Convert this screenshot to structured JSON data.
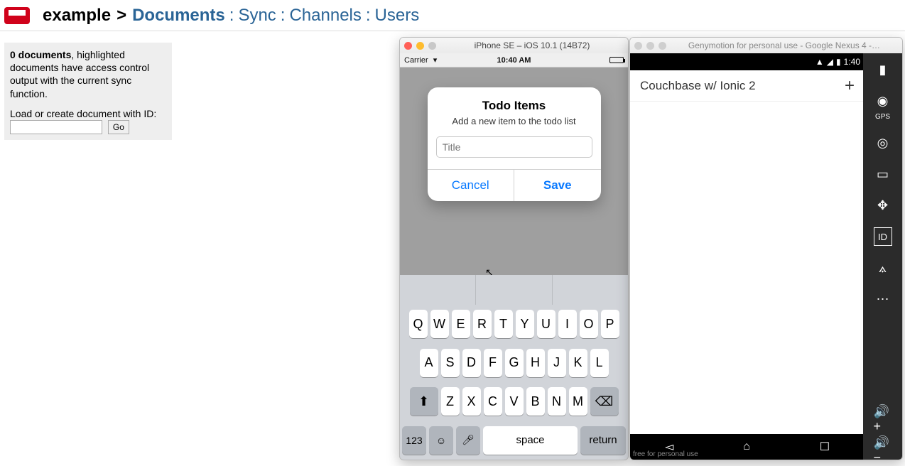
{
  "nav": {
    "db": "example",
    "links": [
      "Documents",
      "Sync",
      "Channels",
      "Users"
    ]
  },
  "info": {
    "count_label": "0 documents",
    "rest": ", highlighted documents have access control output with the current sync function.",
    "load_label": "Load or create document with ID:",
    "go": "Go"
  },
  "ios": {
    "window_title": "iPhone SE – iOS 10.1 (14B72)",
    "carrier": "Carrier",
    "time": "10:40 AM",
    "dialog_title": "Todo Items",
    "dialog_text": "Add a new item to the todo list",
    "placeholder": "Title",
    "cancel": "Cancel",
    "save": "Save",
    "rows": [
      [
        "Q",
        "W",
        "E",
        "R",
        "T",
        "Y",
        "U",
        "I",
        "O",
        "P"
      ],
      [
        "A",
        "S",
        "D",
        "F",
        "G",
        "H",
        "J",
        "K",
        "L"
      ],
      [
        "Z",
        "X",
        "C",
        "V",
        "B",
        "N",
        "M"
      ]
    ],
    "num": "123",
    "space": "space",
    "ret": "return"
  },
  "android": {
    "window_title": "Genymotion for personal use - Google Nexus 4 -…",
    "time": "1:40",
    "header": "Couchbase w/ Ionic 2",
    "note": "free for personal use",
    "gps": "GPS"
  }
}
